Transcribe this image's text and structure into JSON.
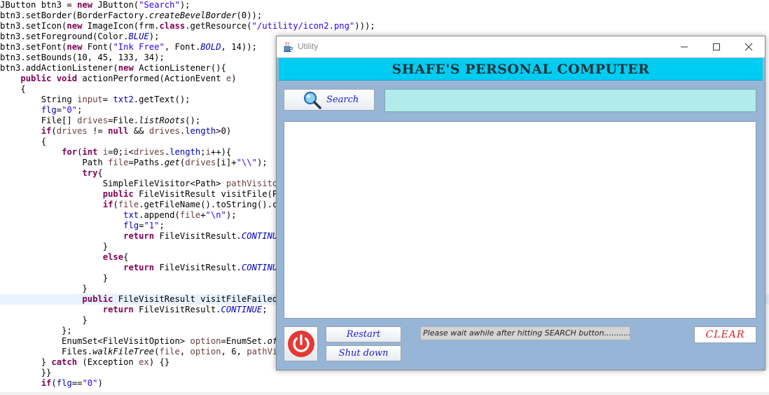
{
  "editor": {
    "lines": [
      [
        {
          "t": "JButton btn3 = "
        },
        {
          "t": "new",
          "c": "kw"
        },
        {
          "t": " JButton("
        },
        {
          "t": "\"Search\"",
          "c": "str"
        },
        {
          "t": ");"
        }
      ],
      [
        {
          "t": "btn3.setBorder(BorderFactory."
        },
        {
          "t": "createBevelBorder",
          "c": "it"
        },
        {
          "t": "(0));"
        }
      ],
      [
        {
          "t": "btn3.setIcon("
        },
        {
          "t": "new",
          "c": "kw"
        },
        {
          "t": " ImageIcon(frm."
        },
        {
          "t": "class",
          "c": "kw"
        },
        {
          "t": ".getResource("
        },
        {
          "t": "\"/utility/icon2.png\"",
          "c": "str"
        },
        {
          "t": ")));"
        }
      ],
      [
        {
          "t": "btn3.setForeground(Color."
        },
        {
          "t": "BLUE",
          "c": "st"
        },
        {
          "t": ");"
        }
      ],
      [
        {
          "t": "btn3.setFont("
        },
        {
          "t": "new",
          "c": "kw"
        },
        {
          "t": " Font("
        },
        {
          "t": "\"Ink Free\"",
          "c": "str"
        },
        {
          "t": ", Font."
        },
        {
          "t": "BOLD",
          "c": "st"
        },
        {
          "t": ", 14));"
        }
      ],
      [
        {
          "t": "btn3.setBounds(10, 45, 133, 34);"
        }
      ],
      [
        {
          "t": "btn3.addActionListener("
        },
        {
          "t": "new",
          "c": "kw"
        },
        {
          "t": " ActionListener(){"
        }
      ],
      [
        {
          "t": "    "
        },
        {
          "t": "public void",
          "c": "kw"
        },
        {
          "t": " actionPerformed(ActionEvent "
        },
        {
          "t": "e",
          "c": "var"
        },
        {
          "t": ")"
        }
      ],
      [
        {
          "t": "    {"
        }
      ],
      [
        {
          "t": "        String "
        },
        {
          "t": "input",
          "c": "var"
        },
        {
          "t": "= "
        },
        {
          "t": "txt2",
          "c": "fld"
        },
        {
          "t": ".getText();"
        }
      ],
      [
        {
          "t": "        "
        },
        {
          "t": "flg",
          "c": "fld"
        },
        {
          "t": "="
        },
        {
          "t": "\"0\"",
          "c": "str"
        },
        {
          "t": ";"
        }
      ],
      [
        {
          "t": "        File[] "
        },
        {
          "t": "drives",
          "c": "var"
        },
        {
          "t": "=File."
        },
        {
          "t": "listRoots",
          "c": "it"
        },
        {
          "t": "();"
        }
      ],
      [
        {
          "t": "        "
        },
        {
          "t": "if",
          "c": "kw"
        },
        {
          "t": "("
        },
        {
          "t": "drives",
          "c": "var"
        },
        {
          "t": " != "
        },
        {
          "t": "null",
          "c": "kw"
        },
        {
          "t": " && "
        },
        {
          "t": "drives",
          "c": "var"
        },
        {
          "t": "."
        },
        {
          "t": "length",
          "c": "fld"
        },
        {
          "t": ">0)"
        }
      ],
      [
        {
          "t": "        {"
        }
      ],
      [
        {
          "t": "            "
        },
        {
          "t": "for",
          "c": "kw"
        },
        {
          "t": "("
        },
        {
          "t": "int",
          "c": "kw"
        },
        {
          "t": " "
        },
        {
          "t": "i",
          "c": "var"
        },
        {
          "t": "=0;"
        },
        {
          "t": "i",
          "c": "var"
        },
        {
          "t": "<"
        },
        {
          "t": "drives",
          "c": "var"
        },
        {
          "t": "."
        },
        {
          "t": "length",
          "c": "fld"
        },
        {
          "t": ";"
        },
        {
          "t": "i",
          "c": "var"
        },
        {
          "t": "++){"
        }
      ],
      [
        {
          "t": "                Path "
        },
        {
          "t": "file",
          "c": "var"
        },
        {
          "t": "=Paths."
        },
        {
          "t": "get",
          "c": "it"
        },
        {
          "t": "("
        },
        {
          "t": "drives",
          "c": "var"
        },
        {
          "t": "[i]+"
        },
        {
          "t": "\"\\\\\"",
          "c": "str"
        },
        {
          "t": ");"
        }
      ],
      [
        {
          "t": "                "
        },
        {
          "t": "try",
          "c": "kw"
        },
        {
          "t": "{"
        }
      ],
      [
        {
          "t": "                    SimpleFileVisitor<Path> "
        },
        {
          "t": "pathVisitor",
          "c": "var"
        }
      ],
      [
        {
          "t": "                    "
        },
        {
          "t": "public",
          "c": "kw"
        },
        {
          "t": " FileVisitResult visitFile(Pa"
        }
      ],
      [
        {
          "t": "                    "
        },
        {
          "t": "if",
          "c": "kw"
        },
        {
          "t": "("
        },
        {
          "t": "file",
          "c": "var"
        },
        {
          "t": ".getFileName().toString().co"
        }
      ],
      [
        {
          "t": "                        "
        },
        {
          "t": "txt",
          "c": "fld"
        },
        {
          "t": ".append("
        },
        {
          "t": "file",
          "c": "var"
        },
        {
          "t": "+"
        },
        {
          "t": "\"\\n\"",
          "c": "str"
        },
        {
          "t": ");"
        }
      ],
      [
        {
          "t": "                        "
        },
        {
          "t": "flg",
          "c": "fld"
        },
        {
          "t": "="
        },
        {
          "t": "\"1\"",
          "c": "str"
        },
        {
          "t": ";"
        }
      ],
      [
        {
          "t": "                        "
        },
        {
          "t": "return",
          "c": "kw"
        },
        {
          "t": " FileVisitResult."
        },
        {
          "t": "CONTINUE",
          "c": "st"
        }
      ],
      [
        {
          "t": "                    }"
        }
      ],
      [
        {
          "t": "                    "
        },
        {
          "t": "else",
          "c": "kw"
        },
        {
          "t": "{"
        }
      ],
      [
        {
          "t": "                        "
        },
        {
          "t": "return",
          "c": "kw"
        },
        {
          "t": " FileVisitResult."
        },
        {
          "t": "CONTINUE",
          "c": "st"
        }
      ],
      [
        {
          "t": "                    }"
        }
      ],
      [
        {
          "t": "                }"
        }
      ],
      [
        {
          "t": "                "
        },
        {
          "t": "public",
          "c": "kw"
        },
        {
          "t": " FileVisitResult visitFileFailed("
        }
      ],
      [
        {
          "t": "                    "
        },
        {
          "t": "return",
          "c": "kw"
        },
        {
          "t": " FileVisitResult."
        },
        {
          "t": "CONTINUE",
          "c": "st"
        },
        {
          "t": ";"
        }
      ],
      [
        {
          "t": "                }"
        }
      ],
      [
        {
          "t": "            };"
        }
      ],
      [
        {
          "t": "            EnumSet<FileVisitOption> "
        },
        {
          "t": "option",
          "c": "var"
        },
        {
          "t": "=EnumSet."
        },
        {
          "t": "of",
          "c": "it"
        },
        {
          "t": "("
        }
      ],
      [
        {
          "t": "            Files."
        },
        {
          "t": "walkFileTree",
          "c": "it"
        },
        {
          "t": "("
        },
        {
          "t": "file",
          "c": "var"
        },
        {
          "t": ", "
        },
        {
          "t": "option",
          "c": "var"
        },
        {
          "t": ", 6, "
        },
        {
          "t": "pathVis",
          "c": "var"
        }
      ],
      [
        {
          "t": "        } "
        },
        {
          "t": "catch",
          "c": "kw"
        },
        {
          "t": " (Exception "
        },
        {
          "t": "ex",
          "c": "var"
        },
        {
          "t": ") {}"
        }
      ],
      [
        {
          "t": "        }}"
        }
      ],
      [
        {
          "t": "        "
        },
        {
          "t": "if",
          "c": "kw"
        },
        {
          "t": "("
        },
        {
          "t": "flg",
          "c": "fld"
        },
        {
          "t": "=="
        },
        {
          "t": "\"0\"",
          "c": "str"
        },
        {
          "t": ")"
        }
      ]
    ]
  },
  "window": {
    "title": "Utility",
    "banner": "SHAFE'S PERSONAL COMPUTER",
    "search_label": "Search",
    "search_value": "",
    "results_text": "",
    "restart_label": "Restart",
    "shutdown_label": "Shut down",
    "status_text": "Please wait awhile after hitting SEARCH button..............",
    "clear_label": "CLEAR",
    "icons": {
      "app": "java-cup-icon",
      "search": "magnifier-icon",
      "power": "power-icon",
      "minimize": "minimize-icon",
      "maximize": "maximize-icon",
      "close": "close-icon"
    }
  },
  "colors": {
    "window_bg": "#97b5d6",
    "banner_bg": "#00ccf2",
    "search_field_bg": "#b1ebec",
    "button_text": "#1b1bd8",
    "clear_text": "#e02020",
    "power_red": "#e53935"
  }
}
